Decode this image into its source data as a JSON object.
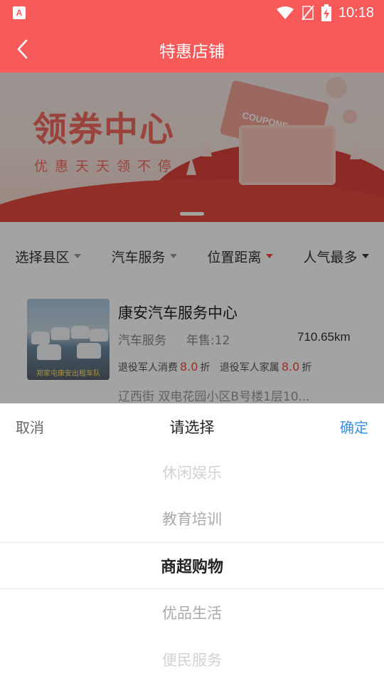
{
  "status_bar": {
    "app_icon_letter": "A",
    "time": "10:18",
    "icons": [
      "wifi-icon",
      "no-sim-icon",
      "battery-charging-icon"
    ]
  },
  "header": {
    "title": "特惠店铺",
    "back_icon": "chevron-left-icon"
  },
  "banner": {
    "title": "领券中心",
    "subtitle": "优惠天天领不停",
    "coupon_label": "COUPONS"
  },
  "filters": [
    {
      "label": "选择县区",
      "active": false
    },
    {
      "label": "汽车服务",
      "active": false
    },
    {
      "label": "位置距离",
      "active": true
    },
    {
      "label": "人气最多",
      "active": false
    }
  ],
  "shop": {
    "name": "康安汽车服务中心",
    "category": "汽车服务",
    "sales": "年售:12",
    "distance": "710.65km",
    "thumb_caption": "郑家屯康安出租车队",
    "discount1_label": "退役军人消费",
    "discount1_value": "8.0",
    "discount1_unit": "折",
    "discount2_label": "退役军人家属",
    "discount2_value": "8.0",
    "discount2_unit": "折",
    "address": "辽西街 双电花园小区B号楼1层10..."
  },
  "picker": {
    "cancel": "取消",
    "title": "请选择",
    "confirm": "确定",
    "options": [
      "休闲娱乐",
      "教育培训",
      "商超购物",
      "优品生活",
      "便民服务"
    ],
    "selected": "商超购物"
  },
  "colors": {
    "brand": "#f85a5a",
    "accent_blue": "#3a8fe8",
    "discount_red": "#f04a3a"
  }
}
